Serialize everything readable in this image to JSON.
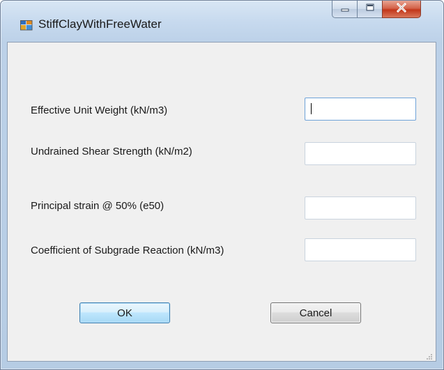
{
  "window": {
    "title": "StiffClayWithFreeWater",
    "icon": "app-form-icon",
    "controls": {
      "minimize_icon": "minimize-icon",
      "maximize_icon": "maximize-icon",
      "close_icon": "close-icon"
    }
  },
  "form": {
    "fields": [
      {
        "label": "Effective Unit Weight (kN/m3)",
        "value": ""
      },
      {
        "label": "Undrained Shear Strength (kN/m2)",
        "value": ""
      },
      {
        "label": "Principal strain @ 50% (e50)",
        "value": ""
      },
      {
        "label": "Coefficient of Subgrade Reaction (kN/m3)",
        "value": ""
      }
    ],
    "ok_label": "OK",
    "cancel_label": "Cancel"
  },
  "colors": {
    "client_bg": "#f0f0f0",
    "frame": "#bcd1e8",
    "close_button": "#c2371b",
    "focus_border": "#6ea2d8"
  }
}
